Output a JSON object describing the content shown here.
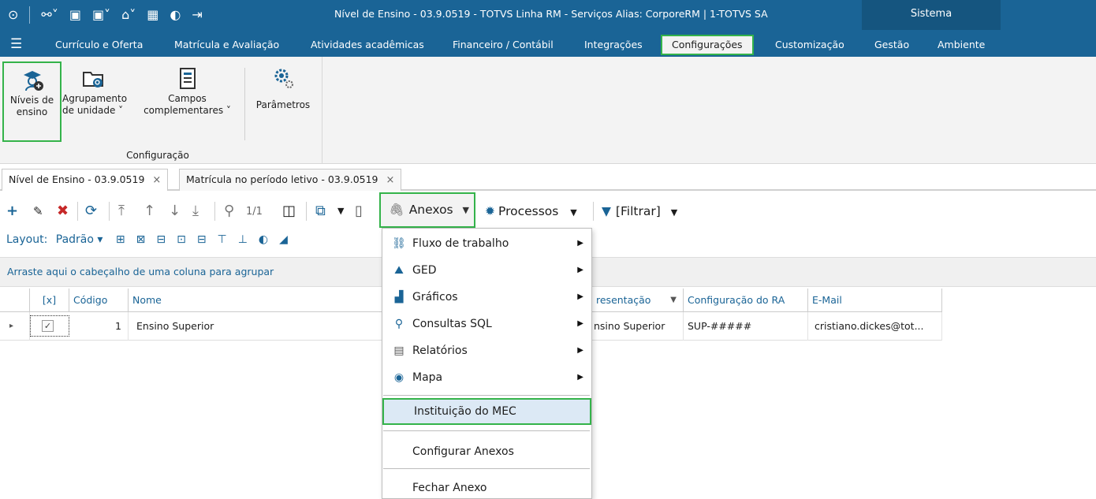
{
  "window": {
    "title": "Nível de Ensino - 03.9.0519 - TOTVS Linha RM - Serviços  Alias: CorporeRM | 1-TOTVS SA",
    "sistema_label": "Sistema"
  },
  "menu": {
    "items": [
      "Currículo e Oferta",
      "Matrícula e Avaliação",
      "Atividades acadêmicas",
      "Financeiro / Contábil",
      "Integrações",
      "Configurações",
      "Customização",
      "Gestão",
      "Ambiente"
    ],
    "active": "Configurações"
  },
  "ribbon": {
    "buttons": [
      {
        "label1": "Níveis de",
        "label2": "ensino",
        "icon": "graduate-icon"
      },
      {
        "label1": "Agrupamento",
        "label2": "de unidade ˅",
        "icon": "folder-search-icon"
      },
      {
        "label1": "Campos",
        "label2": "complementares ˅",
        "icon": "form-icon"
      },
      {
        "label1": "Parâmetros",
        "label2": "",
        "icon": "gears-icon"
      }
    ],
    "group_label": "Configuração"
  },
  "tabs": [
    {
      "label": "Nível de Ensino - 03.9.0519",
      "close": "×"
    },
    {
      "label": "Matrícula no período letivo - 03.9.0519",
      "close": "×"
    }
  ],
  "toolbar": {
    "page_indicator": "1/1",
    "anexos_label": "Anexos",
    "processos_label": "Processos",
    "filtrar_label": "[Filtrar]",
    "layout_label": "Layout:",
    "layout_value": "Padrão ▾"
  },
  "groupbar_text": "Arraste aqui o cabeçalho de uma coluna para agrupar",
  "grid": {
    "headers": [
      "[x]",
      "Código",
      "Nome",
      "resentação",
      "Configuração do RA",
      "E-Mail"
    ],
    "rows": [
      {
        "codigo": "1",
        "nome": "Ensino Superior",
        "apresentacao": "nsino Superior",
        "config_ra": "SUP-#####",
        "email": "cristiano.dickes@tot..."
      }
    ]
  },
  "dropdown": {
    "items": [
      {
        "label": "Fluxo de trabalho",
        "icon": "workflow-icon",
        "submenu": true
      },
      {
        "label": "GED",
        "icon": "ged-icon",
        "submenu": true
      },
      {
        "label": "Gráficos",
        "icon": "chart-icon",
        "submenu": true
      },
      {
        "label": "Consultas SQL",
        "icon": "search-icon",
        "submenu": true
      },
      {
        "label": "Relatórios",
        "icon": "report-icon",
        "submenu": true
      },
      {
        "label": "Mapa",
        "icon": "map-pin-icon",
        "submenu": true
      },
      {
        "label": "Instituição do MEC",
        "icon": "",
        "submenu": false
      },
      {
        "label": "Configurar Anexos",
        "icon": "",
        "submenu": false
      },
      {
        "label": "Fechar Anexo",
        "icon": "",
        "submenu": false
      }
    ]
  },
  "colors": {
    "brand": "#1a6496",
    "highlight": "#34b34a"
  }
}
